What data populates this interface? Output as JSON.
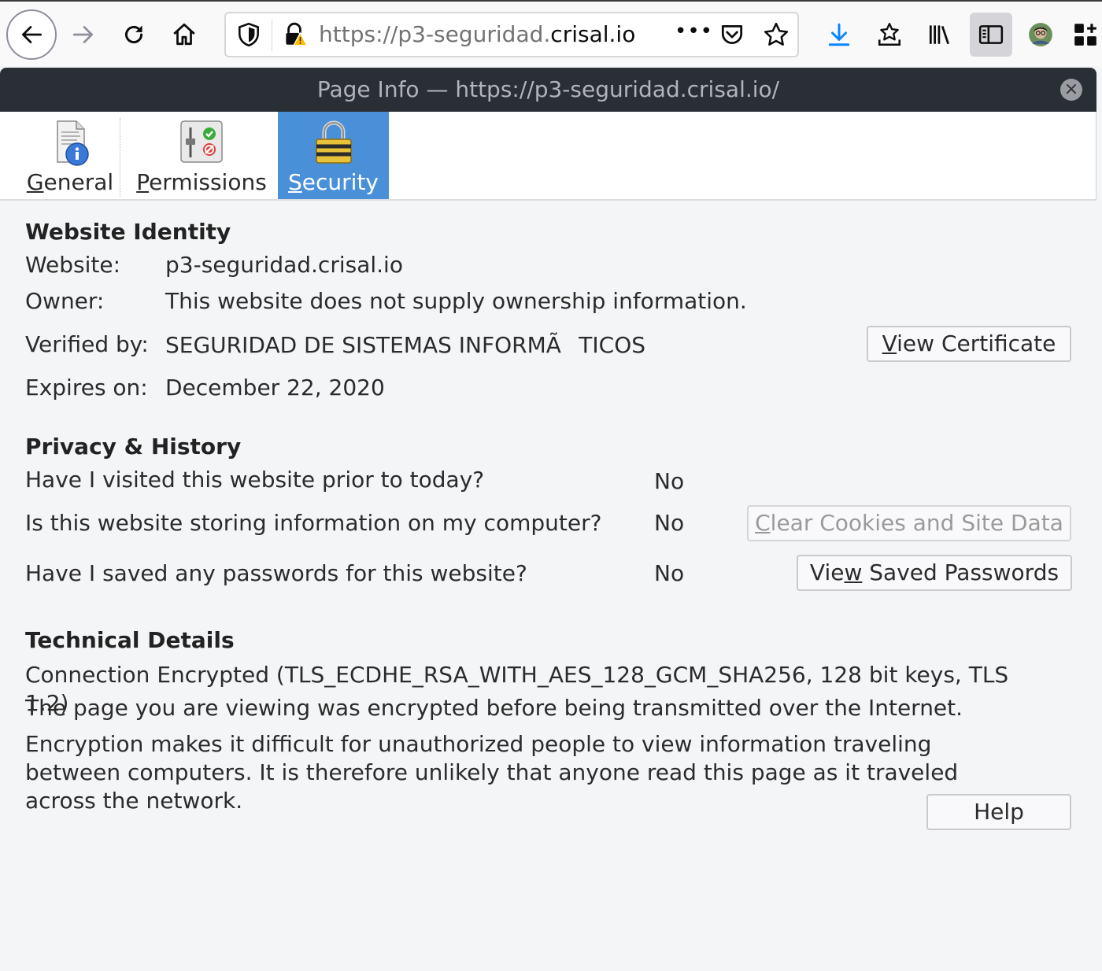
{
  "browser": {
    "url_prefix": "https://p3-seguridad.",
    "url_host": "crisal.io",
    "page_actions_label": "•••"
  },
  "dialog": {
    "title": "Page Info — https://p3-seguridad.crisal.io/",
    "close_label": "×"
  },
  "tabs": [
    {
      "label_first": "G",
      "label_rest": "eneral",
      "icon": "info-page-icon"
    },
    {
      "label_first": "P",
      "label_rest": "ermissions",
      "icon": "permissions-icon"
    },
    {
      "label_first": "S",
      "label_rest": "ecurity",
      "icon": "padlock-icon",
      "selected": true
    }
  ],
  "identity": {
    "title": "Website Identity",
    "website_label": "Website:",
    "website_value": "p3-seguridad.crisal.io",
    "owner_label": "Owner:",
    "owner_value": "This website does not supply ownership information.",
    "verified_label": "Verified by:",
    "verified_value": "SEGURIDAD DE SISTEMAS INFORMÃTICOS",
    "expires_label": "Expires on:",
    "expires_value": "December 22, 2020",
    "view_cert_first": "V",
    "view_cert_rest": "iew Certificate"
  },
  "privacy": {
    "title": "Privacy & History",
    "visited_q": "Have I visited this website prior to today?",
    "visited_a": "No",
    "storing_q": "Is this website storing information on my computer?",
    "storing_a": "No",
    "clear_first": "C",
    "clear_rest": "lear Cookies and Site Data",
    "passwords_q": "Have I saved any passwords for this website?",
    "passwords_a": "No",
    "view_pw_pre": "Vie",
    "view_pw_u": "w",
    "view_pw_post": " Saved Passwords"
  },
  "technical": {
    "title": "Technical Details",
    "connection": "Connection Encrypted (TLS_ECDHE_RSA_WITH_AES_128_GCM_SHA256, 128 bit keys, TLS 1.2)",
    "line1": "The page you are viewing was encrypted before being transmitted over the Internet.",
    "line2": "Encryption makes it difficult for unauthorized people to view information traveling between computers. It is therefore unlikely that anyone read this page as it traveled across the network."
  },
  "help_label": "Help",
  "colors": {
    "selected_tab": "#4a90d9",
    "title_bar": "#2a2e35",
    "download_icon": "#0a84ff",
    "warning": "#ffbf00"
  }
}
